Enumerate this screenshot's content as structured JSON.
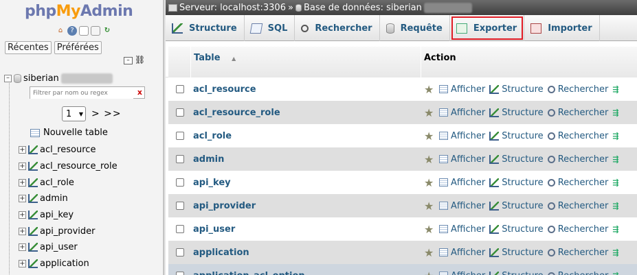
{
  "nav": {
    "logo_php": "php",
    "logo_my": "My",
    "logo_admin": "Admin",
    "recent_label": "Récentes",
    "favorites_label": "Préférées",
    "db_name": "siberian",
    "filter_placeholder": "Filtrer par nom ou regex",
    "filter_clear": "x",
    "page_select": "1",
    "pager_links": "> >>",
    "new_table_label": "Nouvelle table",
    "tables": [
      "acl_resource",
      "acl_resource_role",
      "acl_role",
      "admin",
      "api_key",
      "api_provider",
      "api_user",
      "application"
    ]
  },
  "breadcrumb": {
    "server": "Serveur: localhost:3306",
    "separator": "»",
    "database": "Base de données: siberian"
  },
  "tabs": [
    {
      "label": "Structure",
      "icon": "structure-icon",
      "highlight": false
    },
    {
      "label": "SQL",
      "icon": "sql-icon",
      "highlight": false
    },
    {
      "label": "Rechercher",
      "icon": "search-icon",
      "highlight": false
    },
    {
      "label": "Requête",
      "icon": "query-icon",
      "highlight": false
    },
    {
      "label": "Exporter",
      "icon": "export-icon",
      "highlight": true
    },
    {
      "label": "Importer",
      "icon": "import-icon",
      "highlight": false
    }
  ],
  "table_header": {
    "table": "Table",
    "action": "Action",
    "sort_indicator": "▲"
  },
  "actions": {
    "browse": "Afficher",
    "structure": "Structure",
    "search": "Rechercher"
  },
  "rows": [
    {
      "name": "acl_resource"
    },
    {
      "name": "acl_resource_role"
    },
    {
      "name": "acl_role"
    },
    {
      "name": "admin"
    },
    {
      "name": "api_key"
    },
    {
      "name": "api_provider"
    },
    {
      "name": "api_user"
    },
    {
      "name": "application"
    },
    {
      "name": "application_acl_option"
    }
  ],
  "colors": {
    "link": "#235a81",
    "logo_blue": "#6c78af",
    "logo_orange": "#f89c0e",
    "highlight_box": "#e01b24",
    "row_alt": "#dfdfdf",
    "row_hover": "#ced6df"
  }
}
